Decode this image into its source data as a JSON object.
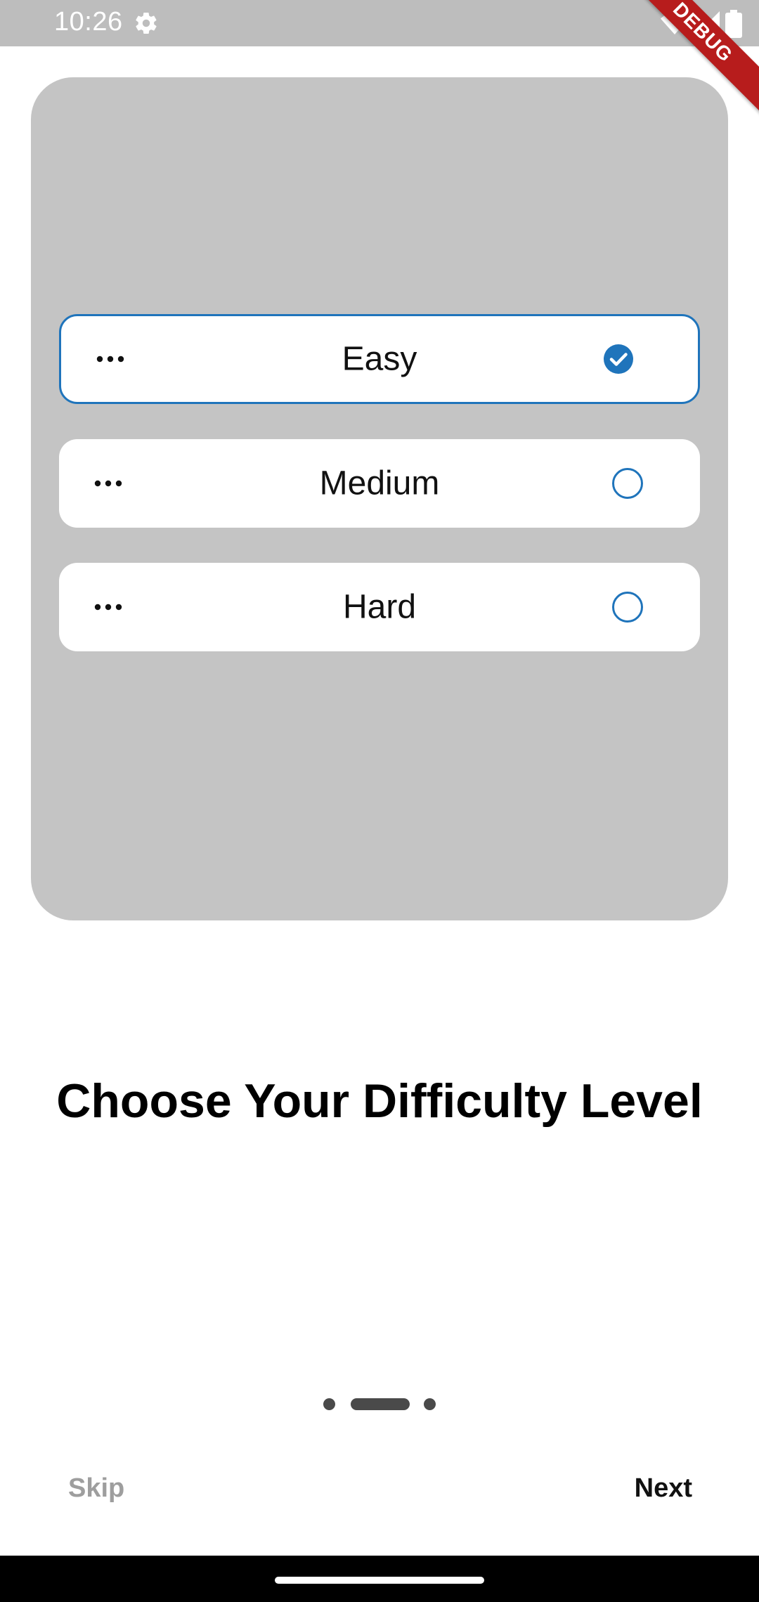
{
  "status_bar": {
    "time": "10:26",
    "icons": [
      "gear-icon",
      "wifi-icon",
      "cell-signal-icon",
      "battery-icon"
    ],
    "debug_banner": "DEBUG"
  },
  "options": [
    {
      "label": "Easy",
      "selected": true,
      "icon": "more-dots-icon"
    },
    {
      "label": "Medium",
      "selected": false,
      "icon": "more-dots-icon"
    },
    {
      "label": "Hard",
      "selected": false,
      "icon": "more-dots-icon"
    }
  ],
  "title": "Choose Your Difficulty Level",
  "pager": {
    "current_page": 2,
    "total_pages": 3
  },
  "buttons": {
    "skip": "Skip",
    "next": "Next"
  },
  "colors": {
    "accent": "#1f74bb",
    "card_background": "#c4c4c4",
    "status_bar": "#bdbdbd",
    "debug_banner": "#b71c1c",
    "skip_text": "#9e9e9e"
  }
}
